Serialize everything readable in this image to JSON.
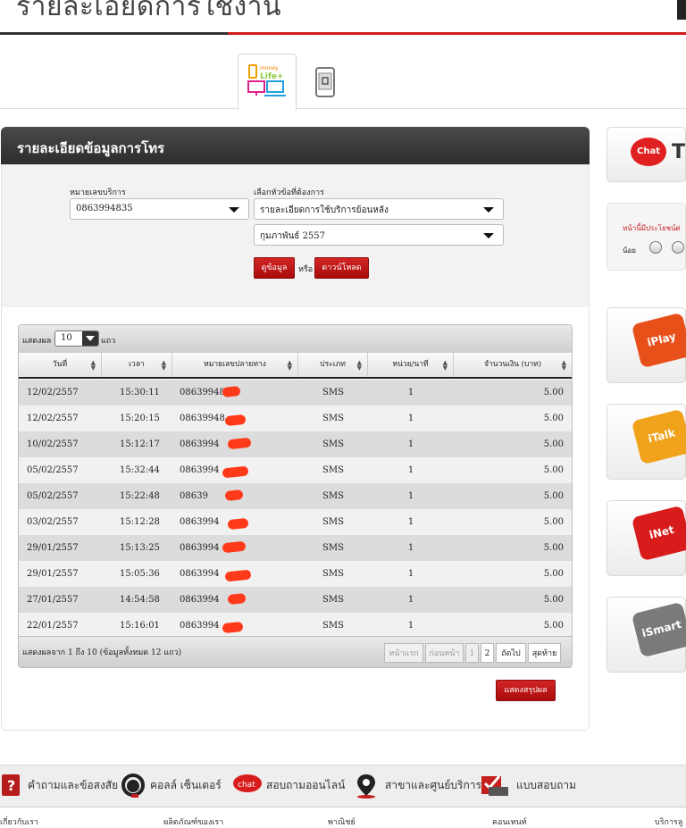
{
  "header": {
    "title": "รายละเอียดการใช้งาน"
  },
  "tabs": [
    {
      "icon": "money-life-plus-icon",
      "active": true,
      "label": "money Life+"
    },
    {
      "icon": "mobile-phone-icon",
      "active": false
    }
  ],
  "panel": {
    "title": "รายละเอียดข้อมูลการโทร",
    "phone_label": "หมายเลขบริการ",
    "phone_value": "0863994835",
    "topic_label": "เลือกหัวข้อที่ต้องการ",
    "topic_value": "รายละเอียดการใช้บริการย้อนหลัง",
    "month_value": "กุมภาพันธ์ 2557",
    "view_button": "ดูข้อมูล",
    "or_text": "หรือ",
    "download_button": "ดาวน์โหลด"
  },
  "table": {
    "show_label": "แสดงผล",
    "page_length": "10",
    "rows_label": "แถว",
    "columns": [
      "วันที่",
      "เวลา",
      "หมายเลขปลายทาง",
      "ประเภท",
      "หน่วย/นาที",
      "จำนวนเงิน (บาท)"
    ],
    "rows": [
      [
        "12/02/2557",
        "15:30:11",
        "08639948",
        "SMS",
        "1",
        "5.00"
      ],
      [
        "12/02/2557",
        "15:20:15",
        "08639948",
        "SMS",
        "1",
        "5.00"
      ],
      [
        "10/02/2557",
        "15:12:17",
        "0863994",
        "SMS",
        "1",
        "5.00"
      ],
      [
        "05/02/2557",
        "15:32:44",
        "0863994",
        "SMS",
        "1",
        "5.00"
      ],
      [
        "05/02/2557",
        "15:22:48",
        "08639",
        "SMS",
        "1",
        "5.00"
      ],
      [
        "03/02/2557",
        "15:12:28",
        "0863994",
        "SMS",
        "1",
        "5.00"
      ],
      [
        "29/01/2557",
        "15:13:25",
        "0863994",
        "SMS",
        "1",
        "5.00"
      ],
      [
        "29/01/2557",
        "15:05:36",
        "0863994",
        "SMS",
        "1",
        "5.00"
      ],
      [
        "27/01/2557",
        "14:54:58",
        "0863994",
        "SMS",
        "1",
        "5.00"
      ],
      [
        "22/01/2557",
        "15:16:01",
        "0863994",
        "SMS",
        "1",
        "5.00"
      ]
    ],
    "info": "แสดงผลจาก 1 ถึง 10 (ข้อมูลทั้งหมด 12 แถว)",
    "pagination": {
      "first": "หน้าแรก",
      "prev": "ก่อนหน้า",
      "page1": "1",
      "page2": "2",
      "next": "ถัดไป",
      "last": "สุดท้าย"
    },
    "summary_button": "แสดงสรุปผล"
  },
  "sidebar": {
    "chat_bubble": "Chat",
    "chat_text": "T",
    "survey_question": "หน้านี้มีประโยชน์ต่",
    "survey_less": "น้อย",
    "keys": [
      {
        "label": "iPlay",
        "color": "#e8501a"
      },
      {
        "label": "iTalk",
        "color": "#f0a21a"
      },
      {
        "label": "iNet",
        "color": "#d81c1c"
      },
      {
        "label": "iSmart",
        "color": "#7a7a7a"
      }
    ]
  },
  "footer": {
    "items": [
      {
        "icon": "question-book-icon",
        "label": "คำถามและข้อสงสัย"
      },
      {
        "icon": "headset-icon",
        "label": "คอลล์ เซ็นเตอร์"
      },
      {
        "icon": "chat-icon",
        "label": "สอบถามออนไลน์"
      },
      {
        "icon": "map-pin-icon",
        "label": "สาขาและศูนย์บริการ"
      },
      {
        "icon": "survey-checklist-icon",
        "label": "แบบสอบถาม"
      }
    ],
    "chat_icon_text": "chat",
    "links": [
      "เกี่ยวกับเรา",
      "ผลิตภัณฑ์ของเรา",
      "พาณิชย์",
      "คอนเทนท์",
      "บริการลู"
    ]
  }
}
